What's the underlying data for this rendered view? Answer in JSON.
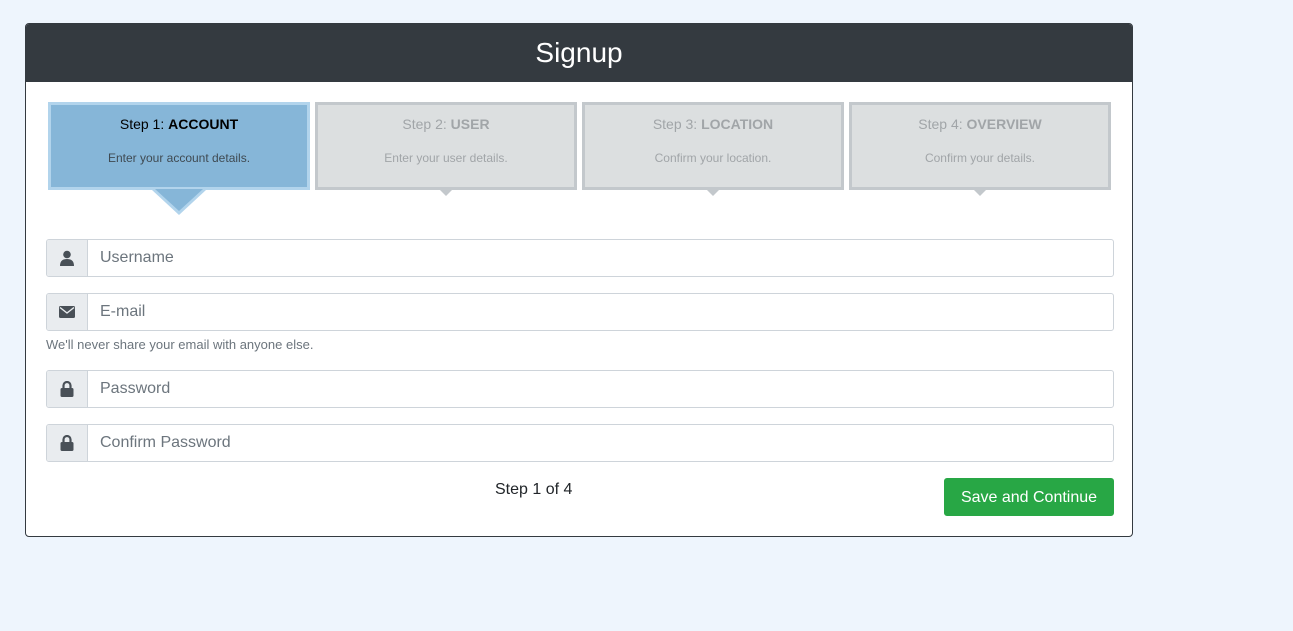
{
  "header": {
    "title": "Signup"
  },
  "steps": [
    {
      "prefix": "Step 1:",
      "name": "ACCOUNT",
      "description": "Enter your account details.",
      "active": true
    },
    {
      "prefix": "Step 2:",
      "name": "USER",
      "description": "Enter your user details.",
      "active": false
    },
    {
      "prefix": "Step 3:",
      "name": "LOCATION",
      "description": "Confirm your location.",
      "active": false
    },
    {
      "prefix": "Step 4:",
      "name": "OVERVIEW",
      "description": "Confirm your details.",
      "active": false
    }
  ],
  "form": {
    "username": {
      "placeholder": "Username",
      "value": "",
      "icon": "user-icon"
    },
    "email": {
      "placeholder": "E-mail",
      "value": "",
      "icon": "envelope-icon",
      "help": "We'll never share your email with anyone else."
    },
    "password": {
      "placeholder": "Password",
      "value": "",
      "icon": "lock-icon"
    },
    "confirm_password": {
      "placeholder": "Confirm Password",
      "value": "",
      "icon": "lock-icon"
    }
  },
  "footer": {
    "step_count": "Step 1 of 4",
    "save_label": "Save and Continue"
  },
  "colors": {
    "header_bg": "#343a40",
    "active_step": "#86b6d8",
    "inactive_step": "#dcdfe0",
    "save_button": "#28a745",
    "page_bg": "#eef5fd"
  }
}
